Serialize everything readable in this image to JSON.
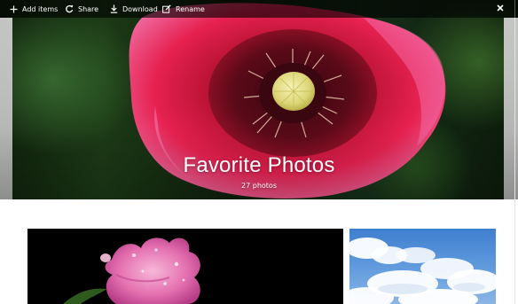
{
  "toolbar": {
    "add_items_label": "Add items",
    "share_label": "Share",
    "download_label": "Download",
    "rename_label": "Rename",
    "icons": {
      "add": "plus-icon",
      "share": "share-icon",
      "download": "download-icon",
      "rename": "rename-icon",
      "close": "close-icon"
    }
  },
  "album": {
    "title": "Favorite Photos",
    "count_text": "27 photos"
  },
  "photos": [
    {
      "subject": "pink flower with water droplets"
    },
    {
      "subject": "blue sky with white clouds"
    }
  ],
  "colors": {
    "toolbar_bg": "#000000",
    "poppy_red": "#e0204a",
    "poppy_center": "#e8e49a",
    "sky_blue": "#4a88d6"
  }
}
